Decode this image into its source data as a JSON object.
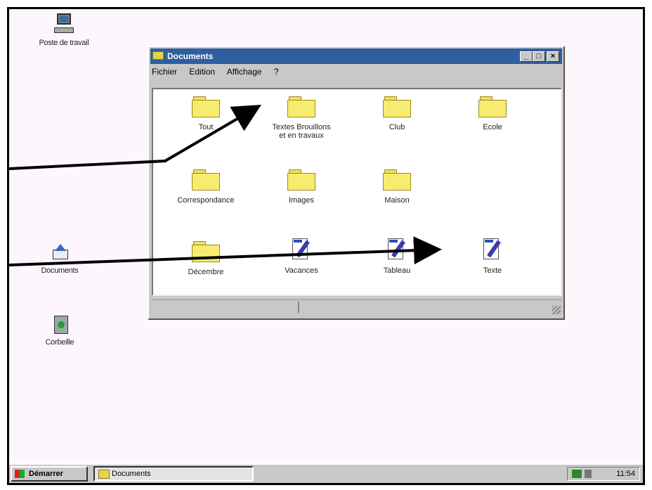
{
  "desktop": {
    "icons": [
      {
        "label": "Poste de travail",
        "icon": "computer-icon"
      },
      {
        "label": "Documents",
        "icon": "documents-icon"
      },
      {
        "label": "Corbeille",
        "icon": "recycle-bin-icon"
      }
    ]
  },
  "window": {
    "title": "Documents",
    "buttons": {
      "minimize": "_",
      "maximize": "□",
      "close": "×"
    },
    "menu": [
      "Fichier",
      "Edition",
      "Affichage",
      "?"
    ],
    "items": [
      {
        "label": "Tout",
        "type": "folder"
      },
      {
        "label": "Textes Brouillons",
        "label2": "et en travaux",
        "type": "folder"
      },
      {
        "label": "Club",
        "type": "folder"
      },
      {
        "label": "Ecole",
        "type": "folder"
      },
      {
        "label": "Correspondance",
        "type": "folder"
      },
      {
        "label": "Images",
        "type": "folder"
      },
      {
        "label": "Maison",
        "type": "folder"
      },
      {
        "label": "Décembre",
        "type": "folder"
      },
      {
        "label": "Vacances",
        "type": "document"
      },
      {
        "label": "Tableau",
        "type": "document"
      },
      {
        "label": "Texte",
        "type": "document"
      }
    ]
  },
  "taskbar": {
    "start_label": "Démarrer",
    "task_label": "Documents",
    "clock": "11:54"
  },
  "colors": {
    "titlebar": "#2f5f9f",
    "folder": "#f8ec70",
    "desktop": "#fdf7fd"
  }
}
